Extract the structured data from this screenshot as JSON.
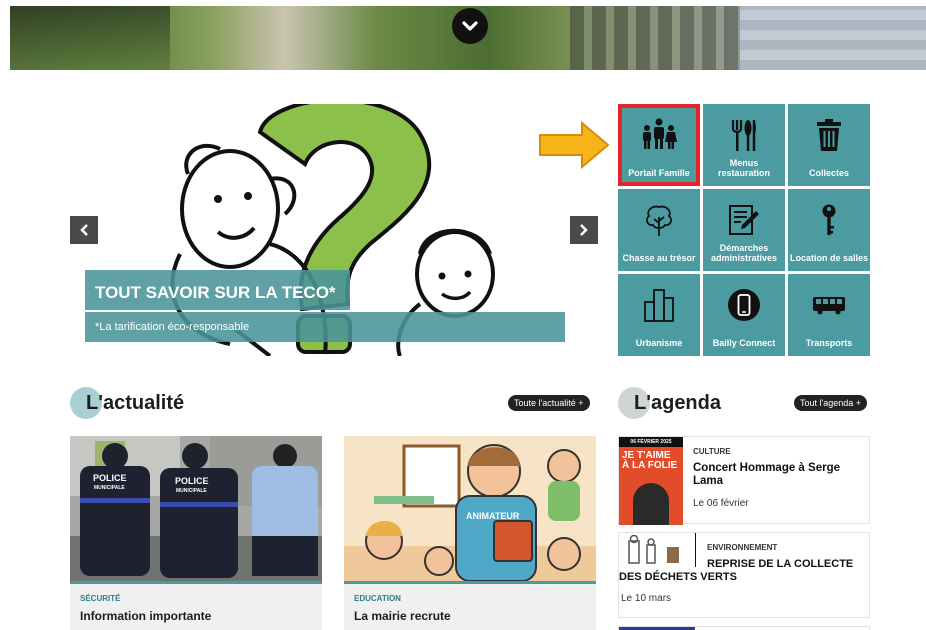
{
  "slider": {
    "title": "TOUT SAVOIR SUR LA TECO*",
    "subtitle": "*La tarification éco-responsable"
  },
  "tiles": [
    {
      "label": "Portail Famille",
      "icon": "family-icon"
    },
    {
      "label": "Menus restauration",
      "icon": "cutlery-icon"
    },
    {
      "label": "Collectes",
      "icon": "trash-icon"
    },
    {
      "label": "Chasse au trésor",
      "icon": "tree-icon"
    },
    {
      "label": "Démarches administratives",
      "icon": "form-pen-icon"
    },
    {
      "label": "Location de salles",
      "icon": "key-icon"
    },
    {
      "label": "Urbanisme",
      "icon": "buildings-icon"
    },
    {
      "label": "Bailly Connect",
      "icon": "smartphone-icon"
    },
    {
      "label": "Transports",
      "icon": "bus-icon"
    }
  ],
  "news": {
    "title": "L'actualité",
    "all_link": "Toute l'actualité +",
    "cards": [
      {
        "category": "SÉCURITÉ",
        "title": "Information importante",
        "img_text_1": "POLICE",
        "img_text_2": "MUNICIPALE"
      },
      {
        "category": "EDUCATION",
        "title": "La mairie recrute",
        "img_text_1": "ANIMATEUR"
      }
    ]
  },
  "agenda": {
    "title": "L'agenda",
    "all_link": "Tout l'agenda +",
    "items": [
      {
        "category": "CULTURE",
        "title": "Concert Hommage à Serge Lama",
        "date": "Le 06 février",
        "poster_top": "06 FÉVRIER 2025",
        "poster_main": "JE T'AIME À LA FOLIE"
      },
      {
        "category": "ENVIRONNEMENT",
        "title": "REPRISE DE LA COLLECTE DES DÉCHETS VERTS",
        "date": "Le 10 mars"
      }
    ]
  },
  "colors": {
    "teal": "#4b9ba1",
    "highlight": "#e3242b",
    "arrow": "#f5b518"
  }
}
